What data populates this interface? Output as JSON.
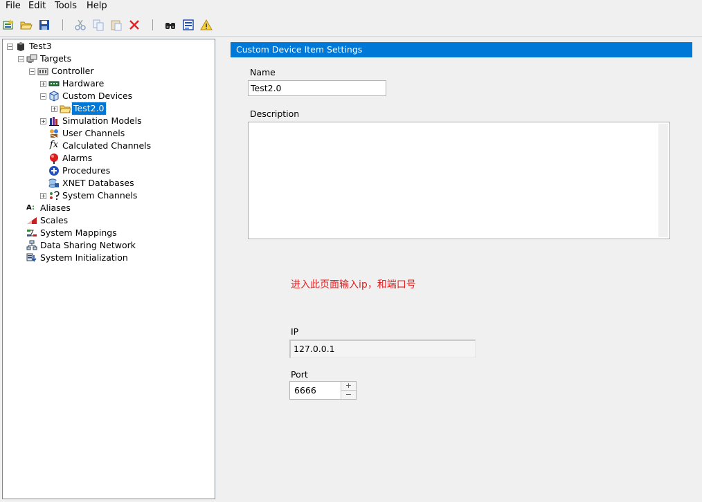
{
  "menu": {
    "file": "File",
    "edit": "Edit",
    "tools": "Tools",
    "help": "Help"
  },
  "toolbar_icons": [
    "new-icon",
    "open-icon",
    "save-icon",
    "cut-icon",
    "copy-icon",
    "paste-icon",
    "delete-icon",
    "find-icon",
    "properties-icon",
    "warning-icon"
  ],
  "tree": {
    "root": "Test3",
    "targets": "Targets",
    "controller": "Controller",
    "hardware": "Hardware",
    "custom_devices": "Custom Devices",
    "test20": "Test2.0",
    "simulation_models": "Simulation Models",
    "user_channels": "User Channels",
    "calculated_channels": "Calculated Channels",
    "alarms": "Alarms",
    "procedures": "Procedures",
    "xnet_databases": "XNET Databases",
    "system_channels": "System Channels",
    "aliases": "Aliases",
    "scales": "Scales",
    "system_mappings": "System Mappings",
    "data_sharing_network": "Data Sharing Network",
    "system_initialization": "System Initialization"
  },
  "panel": {
    "header": "Custom Device Item Settings",
    "name_label": "Name",
    "name_value": "Test2.0",
    "description_label": "Description",
    "description_value": "",
    "annotation": "进入此页面输入ip，和端口号",
    "ip_label": "IP",
    "ip_value": "127.0.0.1",
    "port_label": "Port",
    "port_value": "6666"
  },
  "colors": {
    "selection": "#0078d7",
    "header_bg": "#0078d7",
    "annotation": "#e02020",
    "window_bg": "#f0f0f0"
  }
}
